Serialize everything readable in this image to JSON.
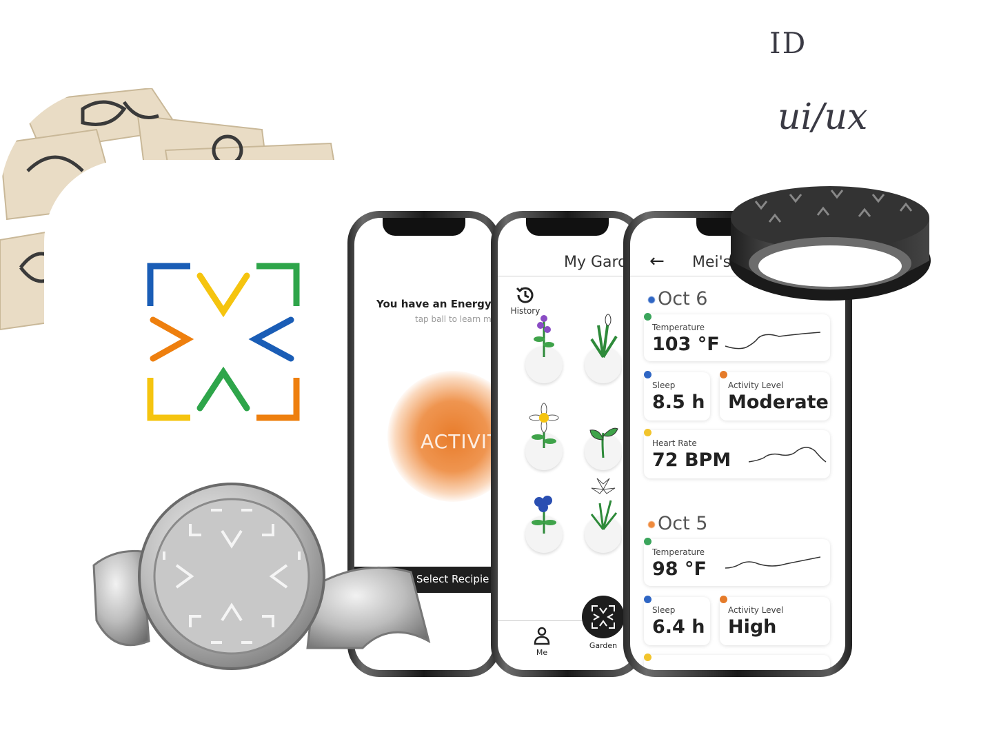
{
  "header": {
    "id_label": "ID",
    "discipline_label": "ui/ux"
  },
  "energy_screen": {
    "title": "You have an Energy",
    "subtitle": "tap ball to learn m",
    "ball_label": "ACTIVIT",
    "select_button": "Select Recipie"
  },
  "garden_screen": {
    "title": "My Gard",
    "history_label": "History",
    "nav": {
      "me_label": "Me",
      "garden_label": "Garden"
    }
  },
  "profile_screen": {
    "back_icon": "arrow-left-icon",
    "title": "Mei's",
    "days": [
      {
        "date": "Oct 6",
        "date_color": "#2f66c4",
        "temperature": {
          "label": "Temperature",
          "value": "103 °F",
          "color": "#3ba55c"
        },
        "sleep": {
          "label": "Sleep",
          "value": "8.5 h",
          "color": "#2f66c4"
        },
        "activity": {
          "label": "Activity Level",
          "value": "Moderate",
          "color": "#e57b2a"
        },
        "heart_rate": {
          "label": "Heart Rate",
          "value": "72 BPM",
          "color": "#f2c42c"
        }
      },
      {
        "date": "Oct 5",
        "date_color": "#ef8a3c",
        "temperature": {
          "label": "Temperature",
          "value": "98 °F",
          "color": "#3ba55c"
        },
        "sleep": {
          "label": "Sleep",
          "value": "6.4 h",
          "color": "#2f66c4"
        },
        "activity": {
          "label": "Activity Level",
          "value": "High",
          "color": "#e57b2a"
        }
      }
    ]
  },
  "logo_colors": {
    "blue": "#1a5db6",
    "yellow": "#f5c40f",
    "green": "#2ea54a",
    "orange": "#ee7f0e"
  }
}
